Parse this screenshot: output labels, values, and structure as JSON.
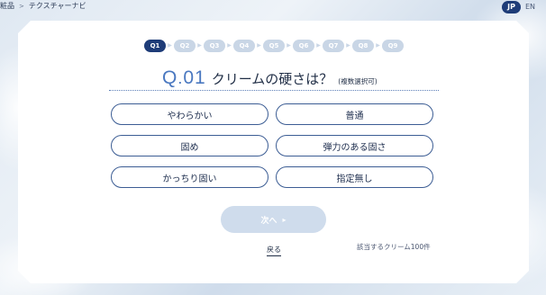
{
  "breadcrumb": {
    "parent": "粧品",
    "separator": ">",
    "current": "テクスチャーナビ"
  },
  "language": {
    "active": "JP",
    "other": "EN"
  },
  "steps": [
    "Q1",
    "Q2",
    "Q3",
    "Q4",
    "Q5",
    "Q6",
    "Q7",
    "Q8",
    "Q9"
  ],
  "active_step": 0,
  "question": {
    "prefix": "Q",
    "dot": ".",
    "number": "01",
    "text": "クリームの硬さは？",
    "note": "(複数選択可)"
  },
  "options": [
    "やわらかい",
    "普通",
    "固め",
    "弾力のある固さ",
    "かっちり固い",
    "指定無し"
  ],
  "next_button": {
    "label": "次へ",
    "enabled": false
  },
  "back_label": "戻る",
  "match_count_text": "該当するクリーム100件",
  "colors": {
    "navy": "#1e3c78",
    "accent_blue": "#4a78c0",
    "step_inactive": "#c9d6e6",
    "button_disabled": "#cfdcec",
    "option_border": "#3c5d94"
  }
}
